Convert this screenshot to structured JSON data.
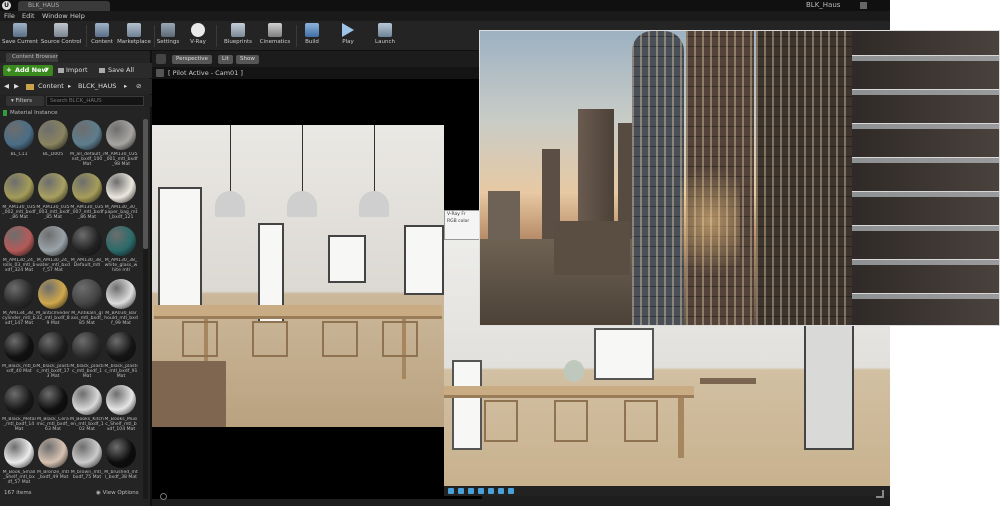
{
  "window": {
    "tab_title": "BLK_HAUS",
    "project_name": "BLK_Haus"
  },
  "menu": [
    "File",
    "Edit",
    "Window",
    "Help"
  ],
  "toolbar": [
    {
      "label": "Save Current",
      "icon": "save-icon"
    },
    {
      "label": "Source Control",
      "icon": "source-control-icon"
    },
    {
      "label": "Content",
      "icon": "content-icon"
    },
    {
      "label": "Marketplace",
      "icon": "marketplace-icon"
    },
    {
      "label": "Settings",
      "icon": "settings-icon"
    },
    {
      "label": "V-Ray",
      "icon": "vray-icon"
    },
    {
      "label": "Blueprints",
      "icon": "blueprints-icon"
    },
    {
      "label": "Cinematics",
      "icon": "cinematics-icon"
    },
    {
      "label": "Build",
      "icon": "build-icon"
    },
    {
      "label": "Play",
      "icon": "play-icon"
    },
    {
      "label": "Launch",
      "icon": "launch-icon"
    }
  ],
  "content_browser": {
    "tab_label": "Content Browser",
    "add_new_label": "Add New",
    "import_label": "Import",
    "save_all_label": "Save All",
    "path_root": "Content",
    "path_current": "BLCK_HAUS",
    "filters_label": "Filters",
    "search_placeholder": "Search BLCK_HAUS",
    "category_label": "Material Instance",
    "item_count": "167 items",
    "view_options_label": "View Options",
    "assets": [
      {
        "name": "BL_C11",
        "color": "#4a6d86"
      },
      {
        "name": "BL_D005",
        "color": "#8a8460"
      },
      {
        "name": "M_all_default_inst_bxdf_100 Mat",
        "color": "#5d7d8e"
      },
      {
        "name": "M_AM130_035_001_mtl_bxdf_98 Mat",
        "color": "#a7a5a2"
      },
      {
        "name": "M_AM130_035_002_mtl_bxdf_86 Mat",
        "color": "#a39c58"
      },
      {
        "name": "M_AM130_035_003_mtl_bxdf_85 Mat",
        "color": "#a8a061"
      },
      {
        "name": "M_AM130_035_007_mtl_bxdf_86 Mat",
        "color": "#a69d59"
      },
      {
        "name": "M_AM130_30_paper_bag_mtl_bxdf_121",
        "color": "#ece8df"
      },
      {
        "name": "M_AM130_24_rolls_03_mtl_bxdf_324 Mat",
        "color": "#b45a58"
      },
      {
        "name": "M_AM130_24_water_mtl_bxdf_57 Mat",
        "color": "#9aa3a8"
      },
      {
        "name": "M_AM130_38_Default_mtl",
        "color": "#222222"
      },
      {
        "name": "M_AM130_38_white_glass_white mtl",
        "color": "#2a6b6a"
      },
      {
        "name": "M_AM134_38_cylinder_mtl_bxdf_147 Mat",
        "color": "#2b2b2b"
      },
      {
        "name": "M_anticmieder32_mtl_bxdf_89 Mat",
        "color": "#d0a84b"
      },
      {
        "name": "M_Antikaln_glass_mtl_bxdf_85 Mat",
        "color": "#444444"
      },
      {
        "name": "M_BA030_Barhould_mtl_bxdf_99 Mat",
        "color": "#dddddd"
      },
      {
        "name": "M_Black_mtl_bxdf_40 Mat",
        "color": "#111111"
      },
      {
        "name": "M_black_plastic_mtl_bxdf_173 Mat",
        "color": "#1d1d1d"
      },
      {
        "name": "M_black_plastic_mtl_bxdf_1 Mat",
        "color": "#2a2a2a"
      },
      {
        "name": "M_black_plastic_mtl_bxdf_91 Mat",
        "color": "#151515"
      },
      {
        "name": "M_Black_Metal_mtl_bxdf_14 Mat",
        "color": "#181818"
      },
      {
        "name": "M_Black_Ceramic_mtl_bxdf_63 Mat",
        "color": "#0f0f0f"
      },
      {
        "name": "M_Books_Kitchen_mtl_bxdf_102 Mat",
        "color": "#d8d8d8"
      },
      {
        "name": "M_Books_Music_Shelf_mtl_bxdf_104 Mat",
        "color": "#e6e6e6"
      },
      {
        "name": "M_Book_Small_Shelf_mtl_bxdf_57 Mat",
        "color": "#ececec"
      },
      {
        "name": "M_Bronze_mtl_bxdf_49 Mat",
        "color": "#d7c2b1"
      },
      {
        "name": "M_brown_mtl_bxdf_75 Mat",
        "color": "#cbcbcb"
      },
      {
        "name": "M_brushed_mtl_bxdf_38 Mat",
        "color": "#0c0c0c"
      }
    ]
  },
  "viewport": {
    "perspective_label": "Perspective",
    "lit_label": "Lit",
    "show_label": "Show",
    "pilot_label": "[ Pilot Active - Cam01 ]"
  },
  "vray_panel": {
    "title": "V-Ray Fr",
    "rgb_label": "RGB color"
  }
}
